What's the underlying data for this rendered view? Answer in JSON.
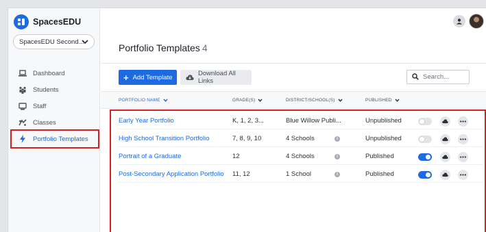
{
  "brand": {
    "name": "SpacesEDU"
  },
  "school_select": {
    "value": "SpacesEDU Second..."
  },
  "nav": [
    {
      "label": "Dashboard",
      "icon": "laptop-icon"
    },
    {
      "label": "Students",
      "icon": "students-icon"
    },
    {
      "label": "Staff",
      "icon": "staff-icon"
    },
    {
      "label": "Classes",
      "icon": "classes-icon"
    },
    {
      "label": "Portfolio Templates",
      "icon": "bolt-icon",
      "active": true
    }
  ],
  "page": {
    "title": "Portfolio Templates",
    "count": "4"
  },
  "toolbar": {
    "add_label": "Add Template",
    "download_label": "Download All Links",
    "search_placeholder": "Search..."
  },
  "table": {
    "columns": {
      "name": "PORTFOLIO NAME",
      "grades": "GRADE(S)",
      "district": "DISTRICT/SCHOOL(S)",
      "published": "PUBLISHED"
    },
    "rows": [
      {
        "name": "Early Year Portfolio",
        "grades": "K, 1, 2, 3...",
        "district": "Blue Willow Publi...",
        "published": "Unpublished",
        "toggle_on": false
      },
      {
        "name": "High School Transition Portfolio",
        "grades": "7, 8, 9, 10",
        "district": "4 Schools",
        "published": "Unpublished",
        "toggle_on": false
      },
      {
        "name": "Portrait of a Graduate",
        "grades": "12",
        "district": "4 Schools",
        "published": "Published",
        "toggle_on": true
      },
      {
        "name": "Post-Secondary Application Portfolio",
        "grades": "11, 12",
        "district": "1 School",
        "published": "Published",
        "toggle_on": true
      }
    ]
  },
  "colors": {
    "accent": "#1e6ae0",
    "highlight": "#d71f1f"
  }
}
